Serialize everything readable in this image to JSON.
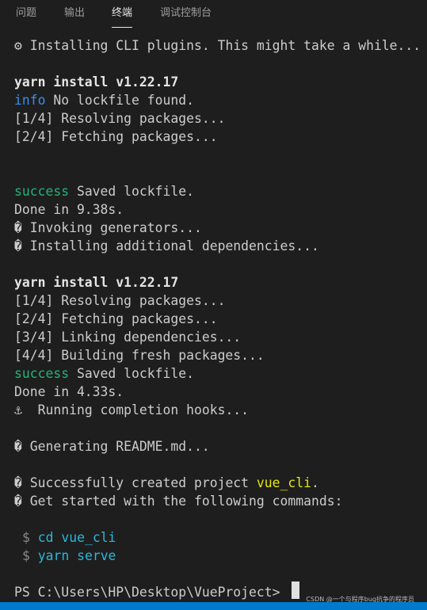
{
  "tabs": [
    {
      "label": "问题"
    },
    {
      "label": "输出"
    },
    {
      "label": "终端"
    },
    {
      "label": "调试控制台"
    }
  ],
  "terminal": {
    "l1_icon": "⚙",
    "l1_text": "Installing CLI plugins. This might take a while...",
    "l2_bold": "yarn install v1.22.17",
    "l3_tag": "info",
    "l3_text": " No lockfile found.",
    "l4": "[1/4] Resolving packages...",
    "l5": "[2/4] Fetching packages...",
    "l6_tag": "success",
    "l6_text": " Saved lockfile.",
    "l7": "Done in 9.38s.",
    "l8_icon": "�",
    "l8_text": " Invoking generators...",
    "l9_icon": "�",
    "l9_text": " Installing additional dependencies...",
    "l10_bold": "yarn install v1.22.17",
    "l11": "[1/4] Resolving packages...",
    "l12": "[2/4] Fetching packages...",
    "l13": "[3/4] Linking dependencies...",
    "l14": "[4/4] Building fresh packages...",
    "l15_tag": "success",
    "l15_text": " Saved lockfile.",
    "l16": "Done in 4.33s.",
    "l17_icon": "⚓",
    "l17_text": "  Running completion hooks...",
    "l18_icon": "�",
    "l18_text": " Generating README.md...",
    "l19_icon": "�",
    "l19_text_a": " Successfully created project ",
    "l19_project": "vue_cli",
    "l19_text_b": ".",
    "l20_icon": "�",
    "l20_text": " Get started with the following commands:",
    "cmd_prompt": "$",
    "cmd1": "cd vue_cli",
    "cmd2": "yarn serve",
    "ps_prompt": "PS C:\\Users\\HP\\Desktop\\VueProject> "
  },
  "watermark": "CSDN @一个与程序bug抗争的程序员",
  "colors": {
    "background": "#1e1e1e",
    "text": "#cccccc",
    "info": "#3b8eea",
    "success": "#23b37a",
    "project": "#e5e510",
    "command": "#29b8db",
    "statusbar": "#007acc"
  }
}
